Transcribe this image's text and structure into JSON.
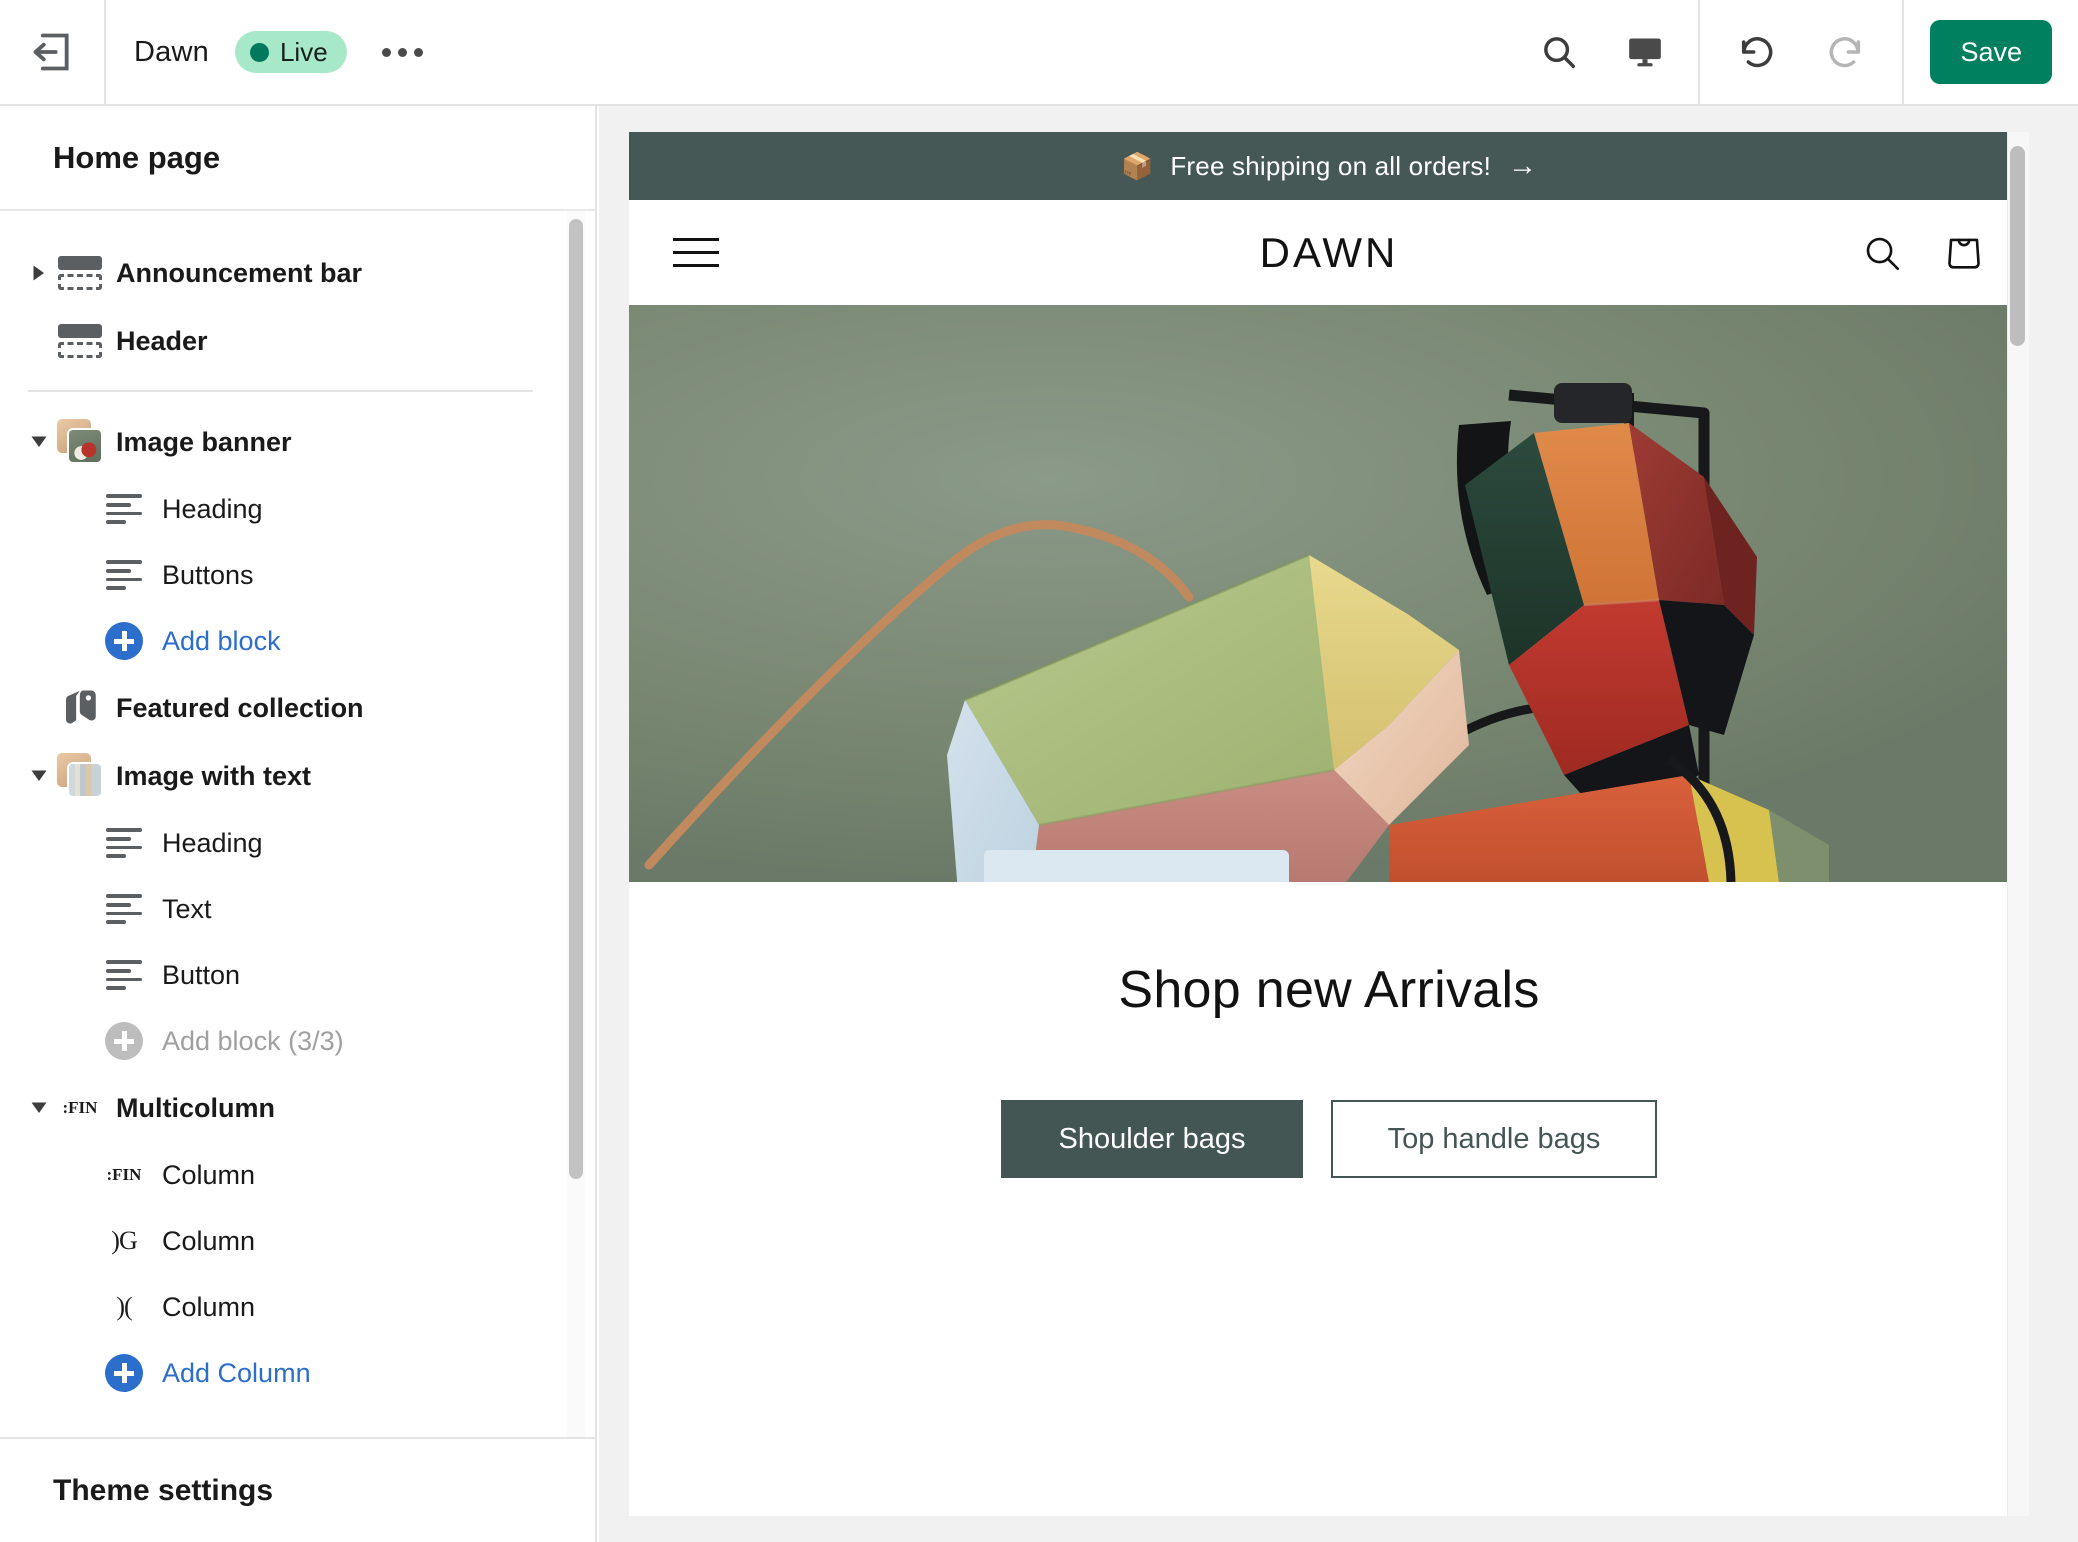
{
  "topbar": {
    "exit_icon": "exit-back-icon",
    "theme_name": "Dawn",
    "status_badge": "Live",
    "more_button": "more-options-icon",
    "search_icon": "search-icon",
    "device_icon": "desktop-view-icon",
    "undo_icon": "undo-icon",
    "redo_icon": "redo-icon",
    "save_label": "Save"
  },
  "sidebar": {
    "title": "Home page",
    "theme_settings_label": "Theme settings",
    "sections": [
      {
        "label": "Announcement bar",
        "icon": "layout-bar-icon",
        "caret": "collapsed",
        "type": "section"
      },
      {
        "label": "Header",
        "icon": "layout-bar-icon",
        "caret": "none",
        "type": "section"
      },
      {
        "label": "Image banner",
        "icon": "image-thumbnail-banner",
        "caret": "expanded",
        "type": "section"
      },
      {
        "label": "Heading",
        "icon": "text-lines-icon",
        "type": "block"
      },
      {
        "label": "Buttons",
        "icon": "text-lines-icon",
        "type": "block"
      },
      {
        "label": "Add block",
        "icon": "plus-circle-icon",
        "type": "add",
        "disabled": false
      },
      {
        "label": "Featured collection",
        "icon": "tag-icon",
        "caret": "none",
        "type": "section"
      },
      {
        "label": "Image with text",
        "icon": "image-thumbnail-iwt",
        "caret": "expanded",
        "type": "section"
      },
      {
        "label": "Heading",
        "icon": "text-lines-icon",
        "type": "block"
      },
      {
        "label": "Text",
        "icon": "text-lines-icon",
        "type": "block"
      },
      {
        "label": "Button",
        "icon": "text-lines-icon",
        "type": "block"
      },
      {
        "label": "Add block (3/3)",
        "icon": "plus-circle-icon",
        "type": "add",
        "disabled": true
      },
      {
        "label": "Multicolumn",
        "icon": "column-thumbnail-icon",
        "caret": "expanded",
        "type": "section"
      },
      {
        "label": "Column",
        "icon": "column-thumb-fin",
        "type": "block"
      },
      {
        "label": "Column",
        "icon": "column-thumb-g",
        "type": "block"
      },
      {
        "label": "Column",
        "icon": "column-thumb-cu",
        "type": "block"
      },
      {
        "label": "Add Column",
        "icon": "plus-circle-icon",
        "type": "add",
        "disabled": false
      }
    ],
    "column_glyphs": {
      "fin": ":FIN",
      "g": ")G",
      "cu": ")("
    }
  },
  "preview": {
    "announcement": {
      "emoji": "📦",
      "text": "Free shipping on all orders!",
      "arrow": "→"
    },
    "store_header": {
      "menu_icon": "hamburger-menu-icon",
      "logo": "DAWN",
      "search_icon": "search-icon",
      "cart_icon": "shopping-bag-icon"
    },
    "hero": {
      "alt": "colorblock leather handbags on sage green background",
      "background_color": "#76856f"
    },
    "content": {
      "heading": "Shop new Arrivals",
      "primary_button": "Shoulder bags",
      "secondary_button": "Top handle bags"
    }
  },
  "colors": {
    "save_green": "#00805f",
    "live_badge_bg": "#a6e8c8",
    "live_dot": "#00795c",
    "link_blue": "#2c6ecb",
    "announcement_bar": "#455856",
    "hero_sage": "#76856f",
    "button_dark": "#435654"
  }
}
